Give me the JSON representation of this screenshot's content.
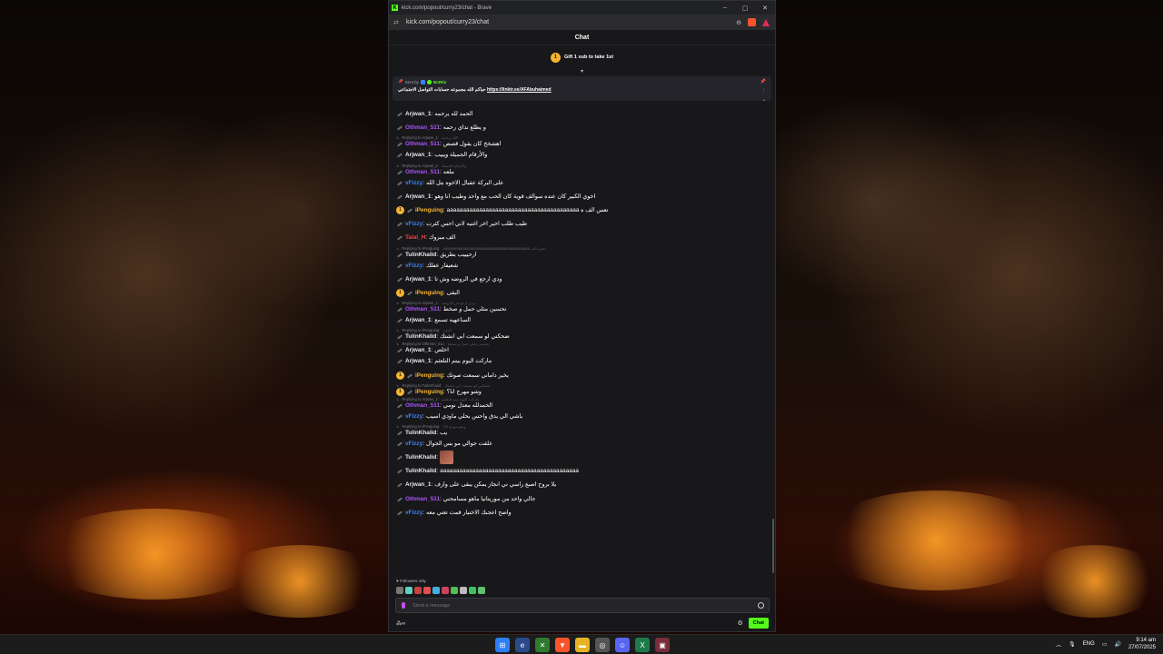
{
  "browser": {
    "title": "kick.com/popout/curry23/chat - Brave",
    "url": "kick.com/popout/curry23/chat",
    "favicon": "K",
    "min": "–",
    "max": "▢",
    "close": "✕"
  },
  "chat": {
    "header": "Chat",
    "gift_badge": "1",
    "gift_text": "Gift 1 sub to take 1st",
    "pinned": {
      "sent_by": "Sent by",
      "bot_name": "BotRix",
      "message": "حياكم الله مجموعه حسابات التواصل الاجتماعي",
      "link": "https://linktr.ee/AFAbuhaimed"
    },
    "messages": [
      {
        "user": "Arjwan_1",
        "color": "#e8e8ea",
        "text": "الحمد لله يرحمه",
        "badge": ""
      },
      {
        "user": "Othman_511",
        "color": "#a855f7",
        "text": "و يطلع نداي رحمه",
        "badge": ""
      },
      {
        "reply": "Replying to Arjwan_1:",
        "reply_text": "الله يرحمه",
        "user": "Othman_511",
        "color": "#a855f7",
        "text": "اهشخخ كان يقول قصص",
        "badge": ""
      },
      {
        "user": "Arjwan_1",
        "color": "#e8e8ea",
        "text": "والأرقام الجميلة ويييب",
        "badge": ""
      },
      {
        "reply": "Replying to Arjwan_1:",
        "reply_text": "والأرقام الجميلة",
        "user": "Othman_511",
        "color": "#a855f7",
        "text": "ملعه",
        "badge": ""
      },
      {
        "user": "vFizzy",
        "color": "#3b82f6",
        "text": "على البركة عقبال الاخوه بتل الله",
        "badge": ""
      },
      {
        "user": "Arjwan_1",
        "color": "#e8e8ea",
        "text": "اخوي الكبير كان عنده سوالف قوية كان الحب مع واحد وطيب انا وهو",
        "badge": ""
      },
      {
        "user": "iPenguing",
        "color": "#f5b531",
        "text": "aaaaaaaaaaaaaaaaaaaaaaaaaaaaaaaaaaaaaaaaa تعس الف ه",
        "badge": "1"
      },
      {
        "user": "vFizzy",
        "color": "#3b82f6",
        "text": "طيب طلب اخير اخر اغنيه لاني احس كثرت",
        "badge": ""
      },
      {
        "user": "Talal_H",
        "color": "#ef4444",
        "text": "الف مبروك",
        "badge": ""
      },
      {
        "reply": "Replying to iPenguing:",
        "reply_text": "aaaaaaaaaaaaaaaaaaaaaaaaaaaaaaaaaaaaaaaaa تعس الف",
        "user": "TulinKhalid",
        "color": "#e8e8ea",
        "text": "ارحيييب بطريق",
        "badge": ""
      },
      {
        "user": "vFizzy",
        "color": "#3b82f6",
        "text": "شعيفار عفلك",
        "badge": ""
      },
      {
        "user": "Arjwan_1",
        "color": "#e8e8ea",
        "text": "ودي ارجع في الروضه وش تا",
        "badge": ""
      },
      {
        "user": "iPenguing",
        "color": "#f5b531",
        "text": "البقى",
        "badge": "1"
      },
      {
        "reply": "Replying to Arjwan_1:",
        "reply_text": "ودي ارجع في الروضه",
        "user": "Othman_511",
        "color": "#a855f7",
        "text": "تحسين مثلي حمل و صخط",
        "badge": ""
      },
      {
        "user": "Arjwan_1",
        "color": "#e8e8ea",
        "text": "الساعهيه تسمع",
        "badge": ""
      },
      {
        "reply": "Replying to iPenguing:",
        "reply_text": "البقى",
        "user": "TulinKhalid",
        "color": "#e8e8ea",
        "text": "ضحكني لو سمعت ابي انشتك",
        "badge": ""
      },
      {
        "reply": "Replying to Othman_511:",
        "reply_text": "تحسين مثلي حمل و صخط",
        "user": "Arjwan_1",
        "color": "#e8e8ea",
        "text": "اخلص",
        "badge": ""
      },
      {
        "user": "Arjwan_1",
        "color": "#e8e8ea",
        "text": "ماركت اليوم بيتم التلعثم",
        "badge": ""
      },
      {
        "user": "iPenguing",
        "color": "#f5b531",
        "text": "يخير داماني سمعت صوتك",
        "badge": "1"
      },
      {
        "reply": "Replying to TulinKhalid:",
        "reply_text": "ضحكني لو سمعت ابي انشتك",
        "user": "iPenguing",
        "color": "#f5b531",
        "text": "وشو مهرج انا؟",
        "badge": "1"
      },
      {
        "reply": "Replying to Arjwan_1:",
        "reply_text": "ماركت اليوم بيتم التلعثم",
        "user": "Othman_511",
        "color": "#a855f7",
        "text": "الحمدلله معدل نومي",
        "badge": ""
      },
      {
        "user": "vFizzy",
        "color": "#3b82f6",
        "text": "ياشي الي يدق واحس بحلي ماودي اسيب",
        "badge": ""
      },
      {
        "reply": "Replying to iPenguing:",
        "reply_text": "وشو مهرج انا؟",
        "user": "TulinKhalid",
        "color": "#e8e8ea",
        "text": "يب",
        "badge": ""
      },
      {
        "user": "vFizzy",
        "color": "#3b82f6",
        "text": "علقت جوالي مو بس الجوال",
        "badge": ""
      },
      {
        "user": "TulinKhalid",
        "color": "#e8e8ea",
        "text": "",
        "badge": "",
        "emote": true
      },
      {
        "user": "TulinKhalid",
        "color": "#e8e8ea",
        "text": "aaaaaaaaaaaaaaaaaaaaaaaaaaaaaaaaaaaaaaaaaaa",
        "badge": ""
      },
      {
        "user": "Arjwan_1",
        "color": "#e8e8ea",
        "text": "يلا بروح اصبغ راسي ني انجاز يمكن يبقى على وارف",
        "badge": ""
      },
      {
        "user": "Othman_511",
        "color": "#a855f7",
        "text": "جالي واحد من موريتانيا ماهو مسامحني",
        "badge": ""
      },
      {
        "user": "vFizzy",
        "color": "#3b82f6",
        "text": "واضح اعجبك الاختيار قمت تغني معه",
        "badge": ""
      }
    ],
    "followers_only": "Followers only",
    "input_placeholder": "Send a message",
    "chat_button": "Chat"
  },
  "taskbar": {
    "lang": "ENG",
    "time": "9:14 am",
    "date": "27/07/2025"
  },
  "colors": {
    "kick_green": "#53fc18",
    "chat_bg": "#18181b"
  }
}
